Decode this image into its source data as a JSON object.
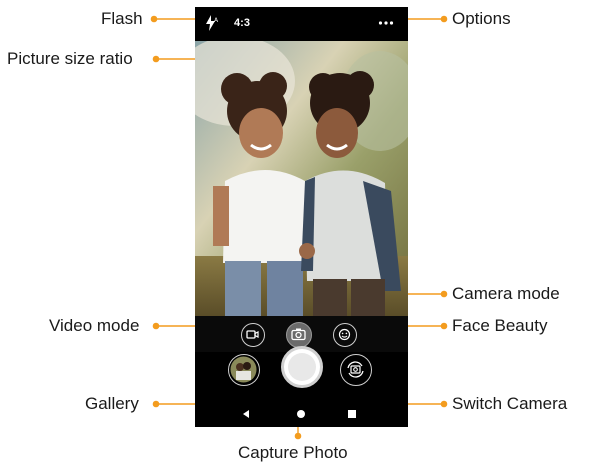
{
  "callouts": {
    "flash": "Flash",
    "picture_size_ratio": "Picture size ratio",
    "options": "Options",
    "camera_mode": "Camera mode",
    "video_mode": "Video mode",
    "face_beauty": "Face Beauty",
    "gallery": "Gallery",
    "switch_camera": "Switch Camera",
    "capture_photo": "Capture Photo"
  },
  "topbar": {
    "ratio_label": "4:3",
    "flash_icon": "flash-auto-icon",
    "options_icon": "more-horizontal-icon"
  },
  "modes": {
    "video_icon": "video-camera-icon",
    "camera_icon": "camera-icon",
    "beauty_icon": "face-smile-icon",
    "selected": "camera"
  },
  "colors": {
    "accent": "#f39c1f",
    "phone_bg": "#000000",
    "label_text": "#1a1a1a"
  }
}
